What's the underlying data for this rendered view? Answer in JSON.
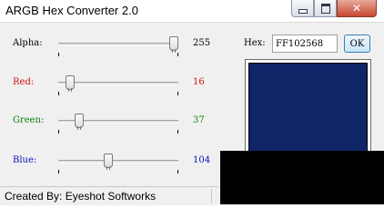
{
  "window": {
    "title": "ARGB Hex Converter 2.0",
    "close_glyph": "✕"
  },
  "sliders": [
    {
      "label": "Alpha:",
      "value": "255",
      "level": 255,
      "max": 255,
      "color": "#000000"
    },
    {
      "label": "Red:",
      "value": "16",
      "level": 16,
      "max": 255,
      "color": "#d01010"
    },
    {
      "label": "Green:",
      "value": "37",
      "level": 37,
      "max": 255,
      "color": "#108010"
    },
    {
      "label": "Blue:",
      "value": "104",
      "level": 104,
      "max": 255,
      "color": "#1010b8"
    }
  ],
  "hex": {
    "label": "Hex:",
    "value": "FF102568",
    "ok_label": "OK"
  },
  "preview": {
    "color": "#102568"
  },
  "status": {
    "text": "Created By: Eyeshot Softworks"
  },
  "icons": [
    "minimize-icon",
    "maximize-icon",
    "close-icon"
  ]
}
